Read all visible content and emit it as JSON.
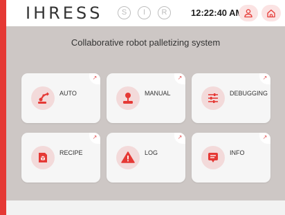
{
  "brand": {
    "logo_text": "IHRESS",
    "accent": "#e53935"
  },
  "header": {
    "status_indicators": [
      {
        "letter": "S",
        "icon": "s-circle-icon"
      },
      {
        "letter": "I",
        "icon": "i-circle-icon"
      },
      {
        "letter": "R",
        "icon": "r-circle-icon"
      }
    ],
    "clock": "12:22:40 AM",
    "buttons": [
      {
        "icon": "user-icon"
      },
      {
        "icon": "home-icon"
      }
    ]
  },
  "main": {
    "title": "Collaborative robot palletizing system",
    "tiles": [
      {
        "label": "AUTO",
        "icon": "robot-arm-icon"
      },
      {
        "label": "MANUAL",
        "icon": "joystick-icon"
      },
      {
        "label": "DEBUGGING",
        "icon": "sliders-icon"
      },
      {
        "label": "RECIPE",
        "icon": "recipe-box-icon"
      },
      {
        "label": "LOG",
        "icon": "warning-icon"
      },
      {
        "label": "INFO",
        "icon": "info-message-icon"
      }
    ],
    "corner_glyph": "↗"
  }
}
